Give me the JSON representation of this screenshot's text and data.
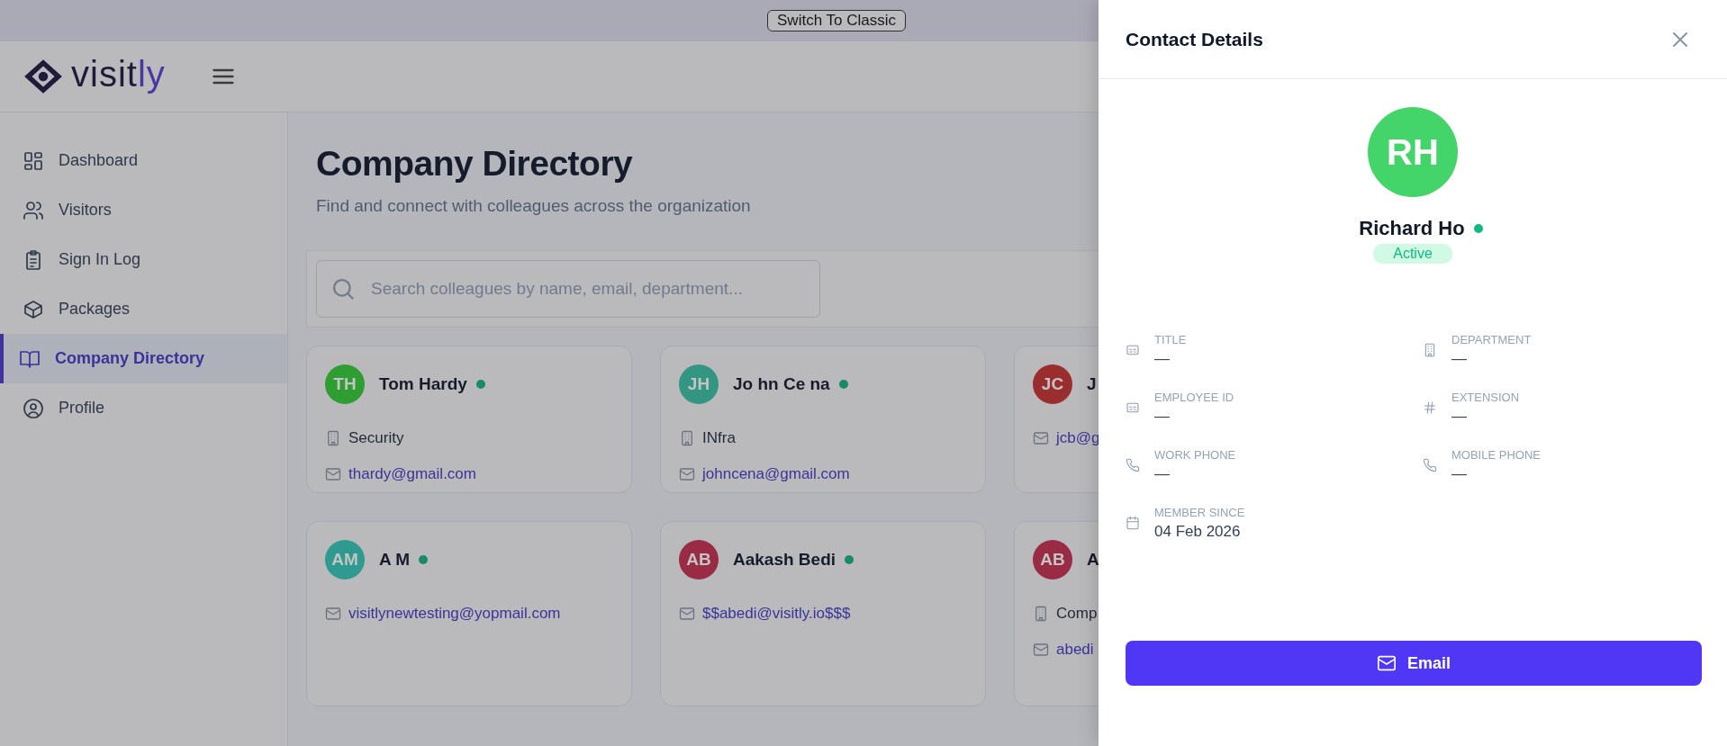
{
  "banner": {
    "button": "Switch To Classic"
  },
  "logo": {
    "text_main": "visit",
    "text_accent": "ly"
  },
  "sidebar": {
    "items": [
      {
        "label": "Dashboard",
        "selected": false
      },
      {
        "label": "Visitors",
        "selected": false
      },
      {
        "label": "Sign In Log",
        "selected": false
      },
      {
        "label": "Packages",
        "selected": false
      },
      {
        "label": "Company Directory",
        "selected": true
      },
      {
        "label": "Profile",
        "selected": false
      }
    ]
  },
  "page": {
    "title": "Company Directory",
    "subtitle": "Find and connect with colleagues across the organization"
  },
  "search": {
    "placeholder": "Search colleagues by name, email, department..."
  },
  "cards": [
    {
      "initials": "TH",
      "color": "#2e9e32",
      "name": "Tom Hardy",
      "online": true,
      "department": "Security",
      "email": "thardy@gmail.com"
    },
    {
      "initials": "JH",
      "color": "#329682",
      "name": "Jo hn Ce na",
      "online": true,
      "department": "INfra",
      "email": "johncena@gmail.com"
    },
    {
      "initials": "JC",
      "color": "#9a2e2e",
      "name": "J",
      "email": "jcb@g"
    },
    {
      "initials": "AM",
      "color": "#2f9a8f",
      "name": "A M",
      "online": true,
      "email": "visitlynewtesting@yopmail.com"
    },
    {
      "initials": "AB",
      "color": "#9a2b45",
      "name": "Aakash Bedi",
      "online": true,
      "email": "$$abedi@visitly.io$$$"
    },
    {
      "initials": "AB",
      "color": "#9a2b45",
      "name": "A",
      "department": "Comp",
      "email": "abedi"
    }
  ],
  "drawer": {
    "title": "Contact Details",
    "initials": "RH",
    "name": "Richard Ho",
    "online": true,
    "status": "Active",
    "fields": [
      {
        "label": "TITLE",
        "value": "—"
      },
      {
        "label": "DEPARTMENT",
        "value": "—"
      },
      {
        "label": "EMPLOYEE ID",
        "value": "—"
      },
      {
        "label": "EXTENSION",
        "value": "—"
      },
      {
        "label": "WORK PHONE",
        "value": "—"
      },
      {
        "label": "MOBILE PHONE",
        "value": "—"
      },
      {
        "label": "MEMBER SINCE",
        "value": "04 Feb 2026"
      }
    ],
    "button": "Email"
  }
}
